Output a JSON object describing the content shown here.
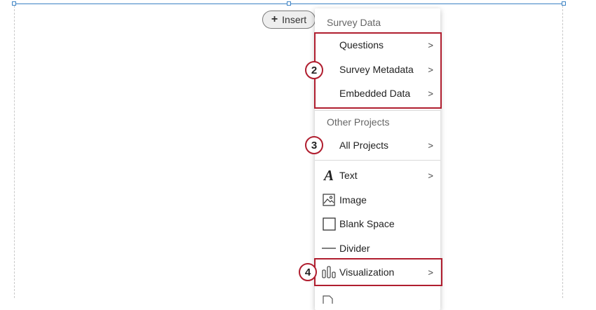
{
  "insert_button": {
    "label": "Insert",
    "icon": "plus-icon"
  },
  "menu": {
    "sections": {
      "survey_data": {
        "header": "Survey Data",
        "items": [
          {
            "label": "Questions",
            "has_submenu": true
          },
          {
            "label": "Survey Metadata",
            "has_submenu": true
          },
          {
            "label": "Embedded Data",
            "has_submenu": true
          }
        ]
      },
      "other_projects": {
        "header": "Other Projects",
        "items": [
          {
            "label": "All Projects",
            "has_submenu": true
          }
        ]
      },
      "widgets": {
        "items": [
          {
            "label": "Text",
            "icon": "text-icon",
            "has_submenu": true
          },
          {
            "label": "Image",
            "icon": "image-icon",
            "has_submenu": false
          },
          {
            "label": "Blank Space",
            "icon": "blank-space-icon",
            "has_submenu": false
          },
          {
            "label": "Divider",
            "icon": "divider-icon",
            "has_submenu": false
          },
          {
            "label": "Visualization",
            "icon": "visualization-icon",
            "has_submenu": true
          }
        ]
      }
    },
    "chevron": ">"
  },
  "callouts": [
    {
      "number": "2"
    },
    {
      "number": "3"
    },
    {
      "number": "4"
    }
  ],
  "colors": {
    "highlight": "#b01e2f",
    "selection": "#3b82c4"
  }
}
